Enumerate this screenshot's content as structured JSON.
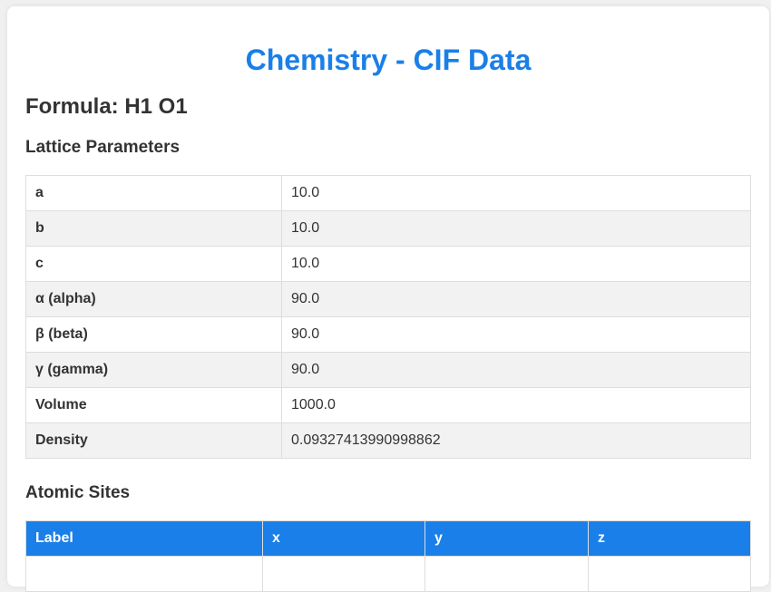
{
  "page": {
    "title": "Chemistry - CIF Data",
    "formula": "Formula: H1 O1"
  },
  "colors": {
    "accent": "#1a7fe8",
    "text": "#333333",
    "row_alt": "#f2f2f2"
  },
  "lattice": {
    "heading": "Lattice Parameters",
    "rows": [
      {
        "key": "a",
        "value": "10.0"
      },
      {
        "key": "b",
        "value": "10.0"
      },
      {
        "key": "c",
        "value": "10.0"
      },
      {
        "key": "α (alpha)",
        "value": "90.0"
      },
      {
        "key": "β (beta)",
        "value": "90.0"
      },
      {
        "key": "γ (gamma)",
        "value": "90.0"
      },
      {
        "key": "Volume",
        "value": "1000.0"
      },
      {
        "key": "Density",
        "value": "0.09327413990998862"
      }
    ]
  },
  "sites": {
    "heading": "Atomic Sites",
    "columns": [
      "Label",
      "x",
      "y",
      "z"
    ]
  }
}
